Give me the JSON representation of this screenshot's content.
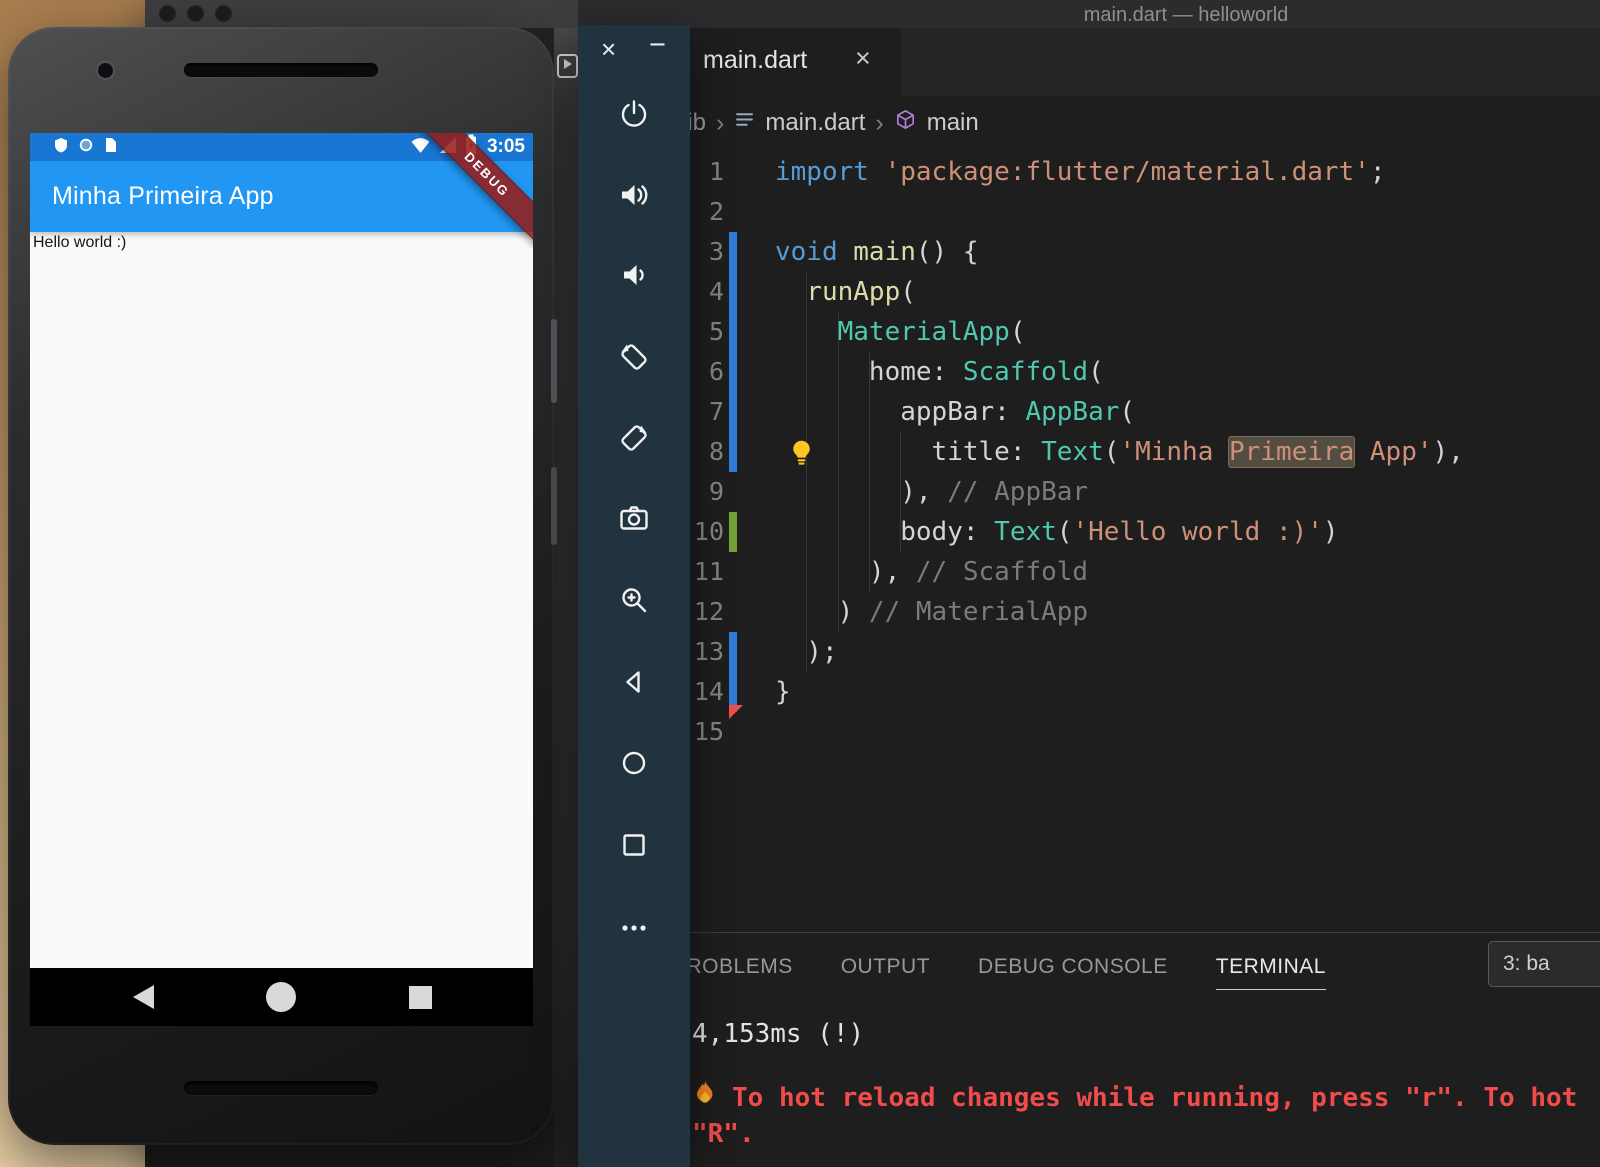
{
  "window": {
    "title": "main.dart — helloworld"
  },
  "emulator_toolbar": {
    "close_glyph": "×",
    "minimize_glyph": "−",
    "icons": [
      "power-icon",
      "volume-up-icon",
      "volume-down-icon",
      "rotate-left-icon",
      "rotate-right-icon",
      "camera-icon",
      "magnifier-icon",
      "back-icon",
      "home-icon",
      "overview-icon",
      "more-icon"
    ]
  },
  "phone": {
    "status": {
      "time": "3:05"
    },
    "status_icons": [
      "notification-icon",
      "circle-icon",
      "sdcard-icon",
      "wifi-icon",
      "cellular-icon",
      "battery-icon"
    ],
    "app_bar_title": "Minha Primeira App",
    "body_text": "Hello world :)",
    "debug_banner": "DEBUG",
    "nav_icons": [
      "back-icon",
      "home-icon",
      "overview-icon"
    ]
  },
  "editor": {
    "tab": {
      "label": "main.dart",
      "close_glyph": "×"
    },
    "breadcrumb": {
      "root": "lib",
      "sep": "›",
      "file": "main.dart",
      "symbol": "main"
    },
    "icons": [
      "file-icon",
      "symbol-cube-icon",
      "lightbulb-icon"
    ],
    "syntax_colors": {
      "keyword": "#569cd6",
      "type": "#4ec9b0",
      "string": "#ce9178",
      "function": "#dcdcaa",
      "comment": "#7b7b7b",
      "plain": "#d4d4d4",
      "line_number": "#858585"
    },
    "gutter_colors": {
      "modified": "#2e7cd6",
      "added": "#74a03a",
      "deleted": "#ef4f47"
    },
    "lines": [
      {
        "n": 1,
        "tokens": [
          [
            "kw",
            "import"
          ],
          [
            "pl",
            " "
          ],
          [
            "str",
            "'package:flutter/material.dart'"
          ],
          [
            "pl",
            ";"
          ]
        ]
      },
      {
        "n": 2,
        "tokens": []
      },
      {
        "n": 3,
        "gutter": "modified",
        "tokens": [
          [
            "kw",
            "void"
          ],
          [
            "pl",
            " "
          ],
          [
            "fn",
            "main"
          ],
          [
            "pl",
            "() {"
          ]
        ]
      },
      {
        "n": 4,
        "gutter": "modified",
        "tokens": [
          [
            "pl",
            "  "
          ],
          [
            "fn",
            "runApp"
          ],
          [
            "pl",
            "("
          ]
        ]
      },
      {
        "n": 5,
        "gutter": "modified",
        "tokens": [
          [
            "pl",
            "    "
          ],
          [
            "cls",
            "MaterialApp"
          ],
          [
            "pl",
            "("
          ]
        ]
      },
      {
        "n": 6,
        "gutter": "modified",
        "tokens": [
          [
            "pl",
            "      "
          ],
          [
            "prop",
            "home"
          ],
          [
            "pl",
            ": "
          ],
          [
            "cls",
            "Scaffold"
          ],
          [
            "pl",
            "("
          ]
        ]
      },
      {
        "n": 7,
        "gutter": "modified",
        "tokens": [
          [
            "pl",
            "        "
          ],
          [
            "prop",
            "appBar"
          ],
          [
            "pl",
            ": "
          ],
          [
            "cls",
            "AppBar"
          ],
          [
            "pl",
            "("
          ]
        ]
      },
      {
        "n": 8,
        "gutter": "modified",
        "tokens": [
          [
            "pl",
            "          "
          ],
          [
            "prop",
            "title"
          ],
          [
            "pl",
            ": "
          ],
          [
            "cls",
            "Text"
          ],
          [
            "pl",
            "("
          ],
          [
            "str",
            "'Minha "
          ],
          [
            "strhl",
            "Primeira"
          ],
          [
            "str",
            " App'"
          ],
          [
            "pl",
            "),"
          ]
        ]
      },
      {
        "n": 9,
        "tokens": [
          [
            "pl",
            "        ), "
          ],
          [
            "cmt",
            "// AppBar"
          ]
        ]
      },
      {
        "n": 10,
        "gutter": "added",
        "tokens": [
          [
            "pl",
            "        "
          ],
          [
            "prop",
            "body"
          ],
          [
            "pl",
            ": "
          ],
          [
            "cls",
            "Text"
          ],
          [
            "pl",
            "("
          ],
          [
            "str",
            "'Hello world :)'"
          ],
          [
            "pl",
            ")"
          ]
        ]
      },
      {
        "n": 11,
        "tokens": [
          [
            "pl",
            "      ), "
          ],
          [
            "cmt",
            "// Scaffold"
          ]
        ]
      },
      {
        "n": 12,
        "tokens": [
          [
            "pl",
            "    ) "
          ],
          [
            "cmt",
            "// MaterialApp"
          ]
        ]
      },
      {
        "n": 13,
        "gutter": "modified",
        "tokens": [
          [
            "pl",
            "  );"
          ]
        ]
      },
      {
        "n": 14,
        "gutter": "modified",
        "tokens": [
          [
            "pl",
            "}"
          ]
        ]
      },
      {
        "n": 15,
        "gutter": "deleted",
        "tokens": []
      }
    ]
  },
  "panel": {
    "tabs": [
      "PROBLEMS",
      "OUTPUT",
      "DEBUG CONSOLE",
      "TERMINAL"
    ],
    "active_tab": "TERMINAL",
    "terminal_dropdown": "3: ba",
    "terminal": {
      "line1": "4,153ms (!)",
      "line2_icon": "fire-icon",
      "line2": "To hot reload changes while running, press \"r\". To hot",
      "line3": "\"R\"."
    }
  },
  "colors": {
    "appbar_blue": "#2196f3",
    "statusbar_blue": "#1976d2",
    "banner_red": "#961c18",
    "terminal_red": "#f14c4c",
    "toolbar_bg": "#21333f",
    "editor_bg": "#1e1e1e"
  }
}
